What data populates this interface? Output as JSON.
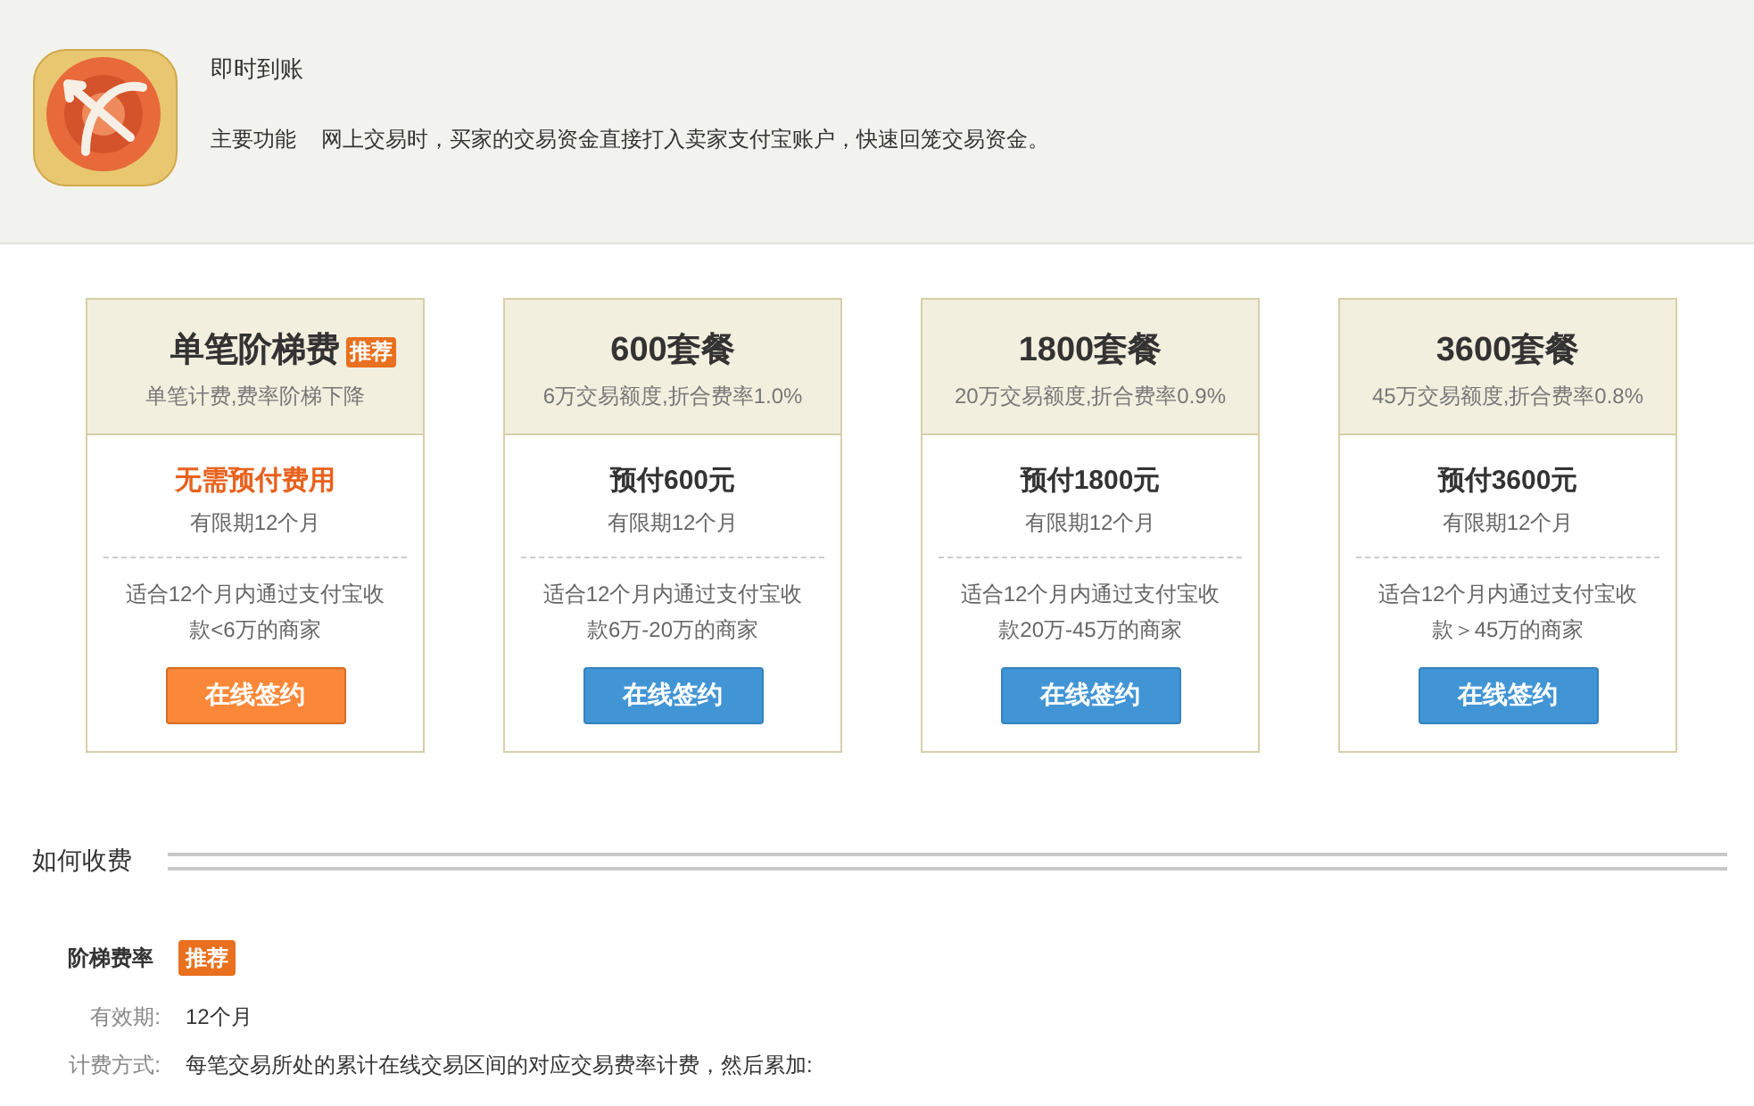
{
  "product": {
    "title": "即时到账",
    "feature_label": "主要功能",
    "feature_text": "网上交易时，买家的交易资金直接打入卖家支付宝账户，快速回笼交易资金。"
  },
  "plans": [
    {
      "kind": "tiered",
      "title": "单笔阶梯费",
      "badge": "推荐",
      "subtitle": "单笔计费,费率阶梯下降",
      "price": "无需预付费用",
      "validity": "有限期12个月",
      "description": "适合12个月内通过支付宝收款<6万的商家",
      "button": "在线签约"
    },
    {
      "kind": "package",
      "title": "600套餐",
      "subtitle": "6万交易额度,折合费率1.0%",
      "price": "预付600元",
      "validity": "有限期12个月",
      "description": "适合12个月内通过支付宝收款6万-20万的商家",
      "button": "在线签约"
    },
    {
      "kind": "package",
      "title": "1800套餐",
      "subtitle": "20万交易额度,折合费率0.9%",
      "price": "预付1800元",
      "validity": "有限期12个月",
      "description": "适合12个月内通过支付宝收款20万-45万的商家",
      "button": "在线签约"
    },
    {
      "kind": "package",
      "title": "3600套餐",
      "subtitle": "45万交易额度,折合费率0.8%",
      "price": "预付3600元",
      "validity": "有限期12个月",
      "description": "适合12个月内通过支付宝收款＞45万的商家",
      "button": "在线签约"
    }
  ],
  "fees": {
    "heading": "如何收费",
    "plan_name": "阶梯费率",
    "badge": "推荐",
    "rows": [
      {
        "label": "有效期:",
        "value": "12个月"
      },
      {
        "label": "计费方式:",
        "value": "每笔交易所处的累计在线交易区间的对应交易费率计费，然后累加:"
      }
    ]
  }
}
